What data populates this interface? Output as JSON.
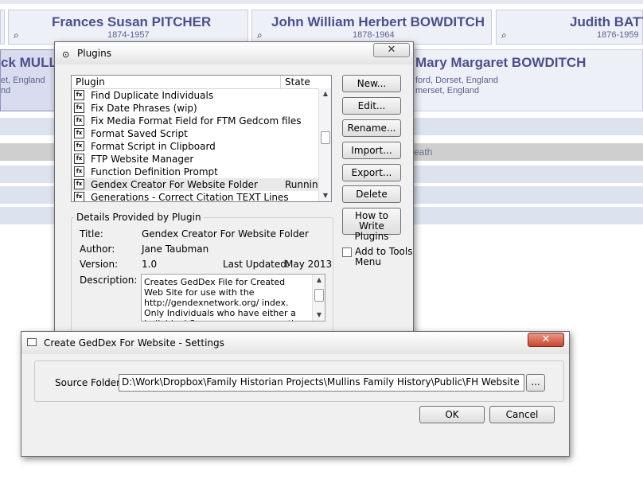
{
  "tree": {
    "people": [
      {
        "name": "Frances Susan PITCHER",
        "dates": "1874-1957"
      },
      {
        "name": "John William Herbert BOWDITCH",
        "dates": "1878-1964"
      },
      {
        "name": "Judith BATT",
        "dates": "1876-1959"
      },
      {
        "name": "ck MULLI",
        "place1": "et, England",
        "place2": "nd"
      },
      {
        "name": "Mary Margaret BOWDITCH",
        "place1": "ford, Dorset, England",
        "place2": "merset, England"
      }
    ],
    "row_text": "eath",
    "magnifier_icon": "magnifier-icon"
  },
  "plugins": {
    "title": "Plugins",
    "columns": {
      "plugin": "Plugin",
      "state": "State"
    },
    "items": [
      {
        "name": "Find Duplicate Individuals",
        "state": ""
      },
      {
        "name": "Fix Date Phrases (wip)",
        "state": ""
      },
      {
        "name": "Fix Media Format Field for FTM Gedcom files",
        "state": ""
      },
      {
        "name": "Format Saved Script",
        "state": ""
      },
      {
        "name": "Format Script in Clipboard",
        "state": ""
      },
      {
        "name": "FTP Website Manager",
        "state": ""
      },
      {
        "name": "Function Definition Prompt",
        "state": ""
      },
      {
        "name": "Gendex Creator For Website Folder",
        "state": "Running"
      },
      {
        "name": "Generations - Correct Citation TEXT Lines",
        "state": ""
      }
    ],
    "buttons": {
      "new": "New...",
      "edit": "Edit...",
      "rename": "Rename...",
      "import": "Import...",
      "export": "Export...",
      "delete": "Delete",
      "how_to_line1": "How to Write",
      "how_to_line2": "Plugins"
    },
    "add_to_tools_line1": "Add to Tools",
    "add_to_tools_line2": "Menu",
    "details": {
      "legend": "Details Provided by Plugin",
      "title_label": "Title:",
      "title_value": "Gendex Creator For Website Folder",
      "author_label": "Author:",
      "author_value": "Jane Taubman",
      "version_label": "Version:",
      "version_value": "1.0",
      "updated_label": "Last Updated:",
      "updated_value": "May 2013",
      "description_label": "Description:",
      "description_value": "Creates GedDex File for Created Web Site for use with the http://gendexnetwork.org/ index. Only Individuals who have either a Individual Summary page or are the spouse"
    }
  },
  "settings": {
    "title": "Create GedDex For Website - Settings",
    "source_folder_label": "Source Folder",
    "source_folder_value": "D:\\Work\\Dropbox\\Family Historian Projects\\Mullins Family History\\Public\\FH Website",
    "browse_label": "...",
    "ok_label": "OK",
    "cancel_label": "Cancel"
  },
  "colors": {
    "accent_text": "#4a4f8c",
    "close_red": "#c9452d"
  }
}
